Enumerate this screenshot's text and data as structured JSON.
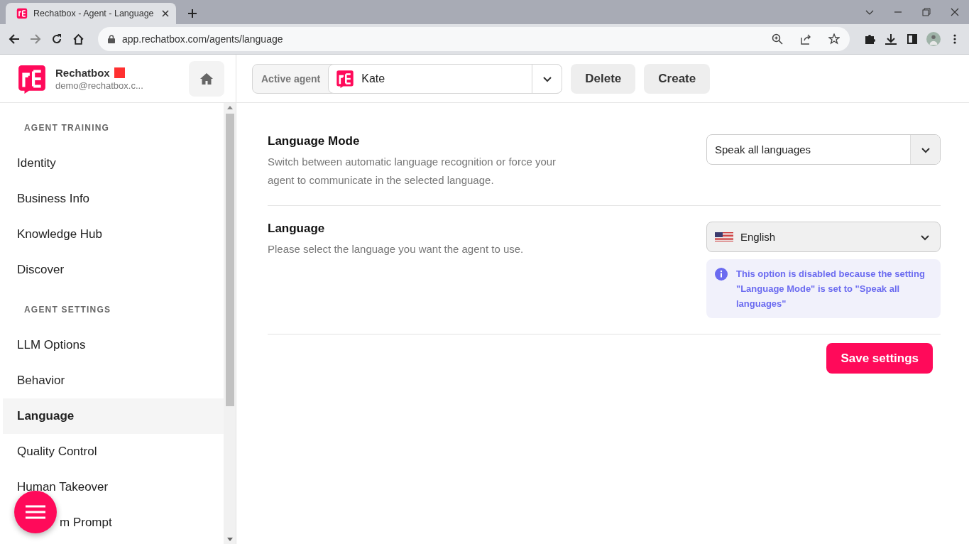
{
  "browser": {
    "tab_title": "Rechatbox - Agent - Language",
    "url": "app.rechatbox.com/agents/language"
  },
  "account": {
    "name": "Rechatbox",
    "email": "demo@rechatbox.c..."
  },
  "agent_bar": {
    "label": "Active agent",
    "agent": "Kate",
    "buttons": [
      "Delete",
      "Create"
    ]
  },
  "sidebar": {
    "sections": [
      {
        "heading": "AGENT TRAINING",
        "items": [
          {
            "label": "Identity",
            "selected": false
          },
          {
            "label": "Business Info",
            "selected": false
          },
          {
            "label": "Knowledge Hub",
            "selected": false
          },
          {
            "label": "Discover",
            "selected": false
          }
        ]
      },
      {
        "heading": "AGENT SETTINGS",
        "items": [
          {
            "label": "LLM Options",
            "selected": false
          },
          {
            "label": "Behavior",
            "selected": false
          },
          {
            "label": "Language",
            "selected": true
          },
          {
            "label": "Quality Control",
            "selected": false
          },
          {
            "label": "Human Takeover",
            "selected": false
          },
          {
            "label": "m Prompt",
            "selected": false,
            "covered": true
          }
        ]
      }
    ]
  },
  "settings": [
    {
      "title": "Language Mode",
      "description": "Switch between automatic language recognition or force your agent to communicate in the selected language.",
      "value": "Speak all languages",
      "disabled": false,
      "flag": false
    },
    {
      "title": "Language",
      "description": "Please select the language you want the agent to use.",
      "value": "English",
      "disabled": true,
      "flag": true,
      "notice": "This option is disabled because the setting \"Language Mode\" is set to \"Speak all languages\""
    }
  ],
  "save_button": "Save settings"
}
